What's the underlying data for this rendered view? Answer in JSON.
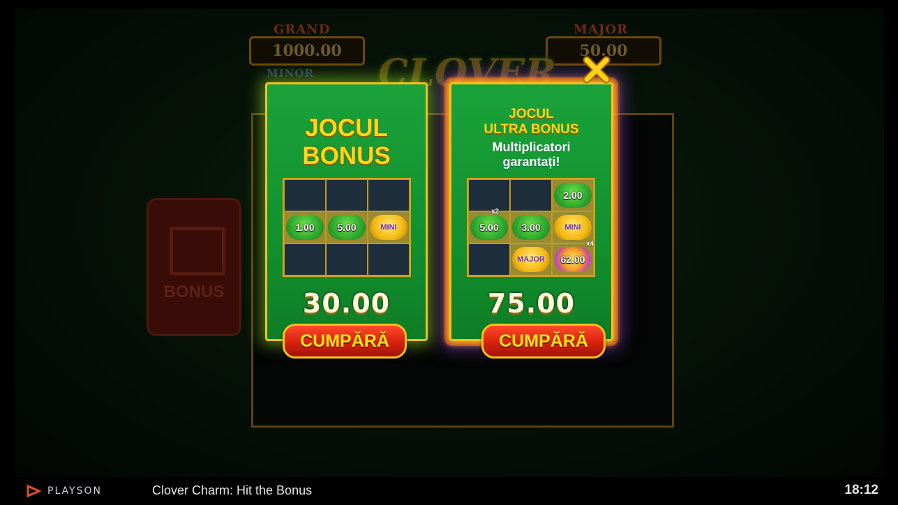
{
  "background": {
    "jackpots": [
      "GRAND",
      "1000.00",
      "MINOR",
      "MAJOR",
      "50.00"
    ],
    "logo": "CLOVER",
    "buy_bonus_label": "BONUS"
  },
  "cards": [
    {
      "title_lines": [
        "JOCUL",
        "BONUS"
      ],
      "grid": [
        [
          "",
          "",
          ""
        ],
        [
          "1.00",
          "5.00",
          "MINI"
        ],
        [
          "",
          "",
          ""
        ]
      ],
      "price": "30.00",
      "buy_label": "CUMPĂRĂ"
    },
    {
      "title_lines": [
        "JOCUL",
        "ULTRA BONUS"
      ],
      "subtitle_lines": [
        "Multiplicatori",
        "garantați!"
      ],
      "grid": [
        [
          "",
          "",
          "2.00"
        ],
        [
          "5.00",
          "3.00",
          "MINI"
        ],
        [
          "",
          "MAJOR",
          "62.00"
        ]
      ],
      "multipliers": [
        "x2",
        "x4"
      ],
      "price": "75.00",
      "buy_label": "CUMPĂRĂ"
    }
  ],
  "close_icon": "close-x-icon",
  "footer": {
    "brand": "PLAYSON",
    "video_title": "Clover Charm: Hit the Bonus",
    "time": "18:12"
  },
  "colors": {
    "accent_yellow": "#ffd61a",
    "card_green": "#1aa23a",
    "button_red": "#d8200c",
    "border_gold": "#f6c21b"
  }
}
